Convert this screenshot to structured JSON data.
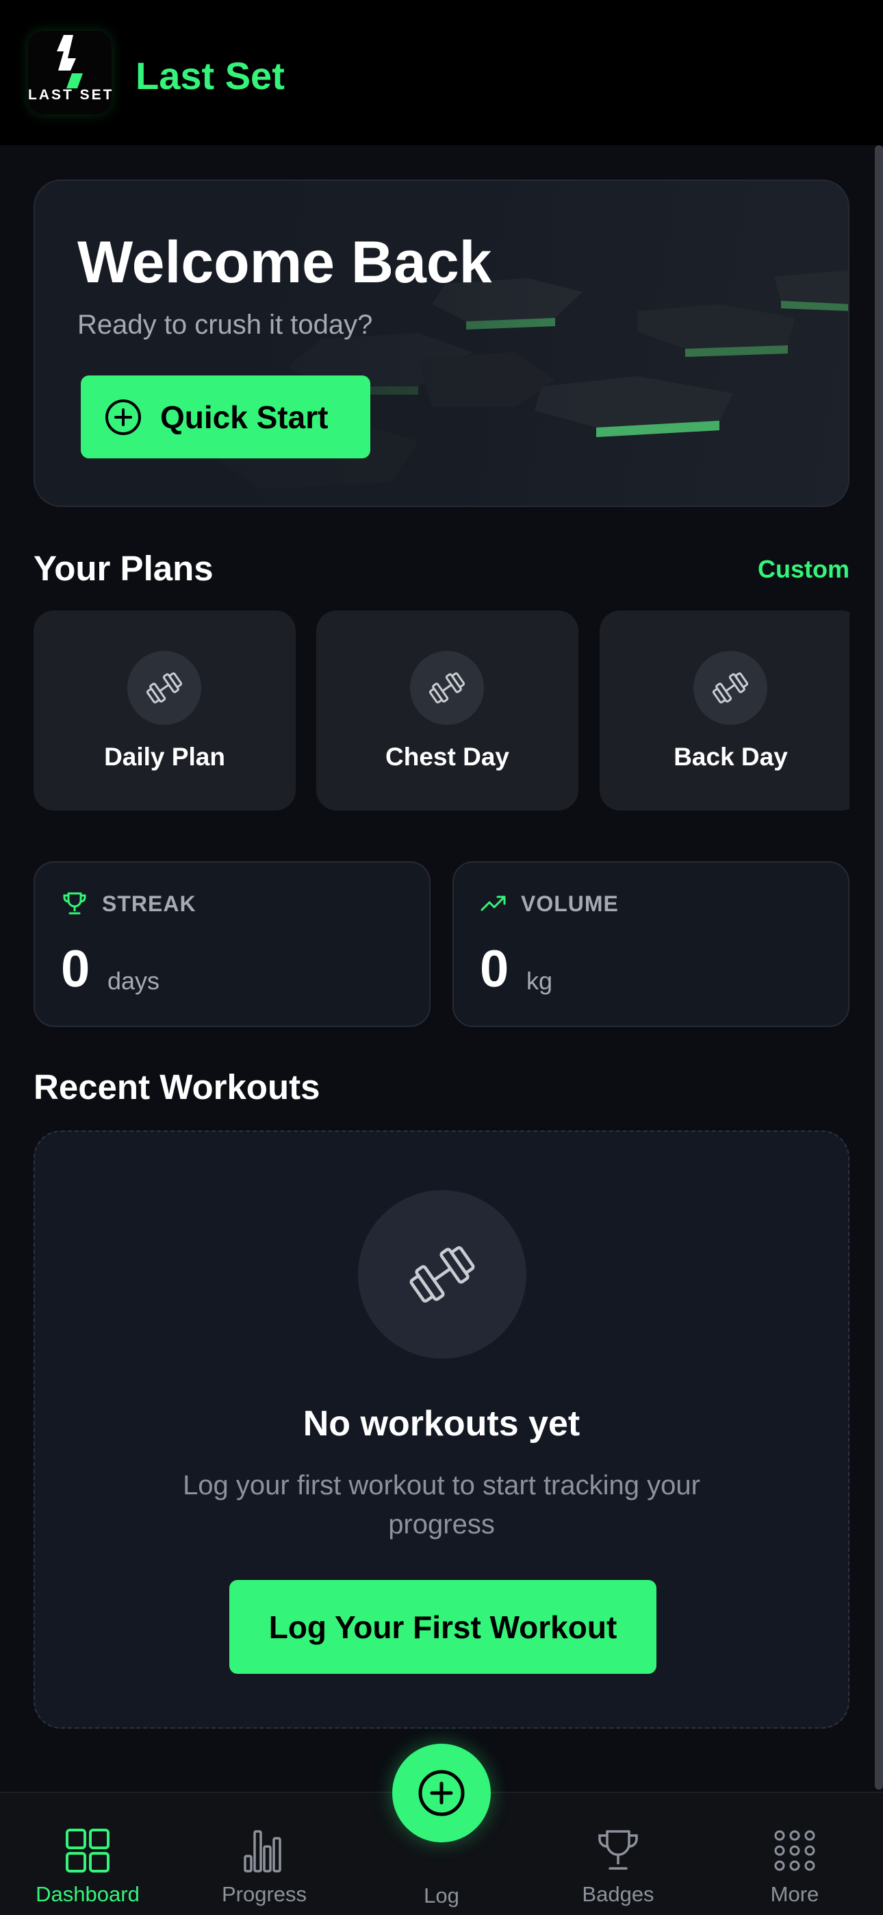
{
  "header": {
    "app_title": "Last Set",
    "logo_text": "LAST SET"
  },
  "hero": {
    "title": "Welcome Back",
    "subtitle": "Ready to crush it today?",
    "quick_start_label": "Quick Start"
  },
  "plans": {
    "title": "Your Plans",
    "custom_label": "Custom",
    "items": [
      {
        "label": "Daily Plan",
        "icon": "dumbbell-icon"
      },
      {
        "label": "Chest Day",
        "icon": "dumbbell-icon"
      },
      {
        "label": "Back Day",
        "icon": "dumbbell-icon"
      }
    ]
  },
  "stats": {
    "streak": {
      "title": "STREAK",
      "value": "0",
      "unit": "days",
      "icon": "trophy-icon"
    },
    "volume": {
      "title": "VOLUME",
      "value": "0",
      "unit": "kg",
      "icon": "trending-up-icon"
    }
  },
  "recent": {
    "title": "Recent Workouts",
    "empty_title": "No workouts yet",
    "empty_desc": "Log your first workout to start tracking your progress",
    "cta_label": "Log Your First Workout"
  },
  "nav": {
    "items": [
      {
        "label": "Dashboard",
        "icon": "grid-icon",
        "active": true
      },
      {
        "label": "Progress",
        "icon": "bar-chart-icon",
        "active": false
      },
      {
        "label": "Log",
        "icon": "plus-circle-icon",
        "active": false
      },
      {
        "label": "Badges",
        "icon": "trophy-icon",
        "active": false
      },
      {
        "label": "More",
        "icon": "apps-icon",
        "active": false
      }
    ]
  },
  "colors": {
    "accent": "#34f57a",
    "background": "#0b0d12",
    "card": "#1c1f26",
    "muted_text": "#8d929c"
  }
}
